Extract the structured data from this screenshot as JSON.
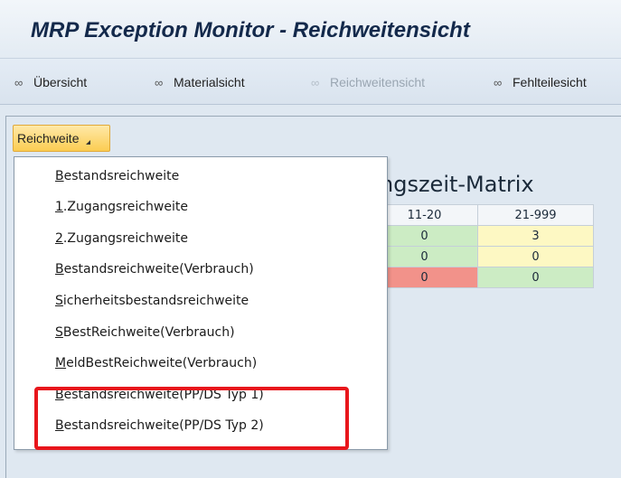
{
  "window": {
    "title": "MRP Exception Monitor - Reichweitensicht"
  },
  "toolbar": {
    "items": [
      {
        "label": "Übersicht",
        "icon": "glasses-icon",
        "enabled": true
      },
      {
        "label": "Materialsicht",
        "icon": "glasses-icon",
        "enabled": true
      },
      {
        "label": "Reichweitensicht",
        "icon": "glasses-icon",
        "enabled": false
      },
      {
        "label": "Fehlteilesicht",
        "icon": "glasses-icon",
        "enabled": true
      }
    ]
  },
  "dropdown": {
    "label": "Reichweite",
    "open": true
  },
  "menu": {
    "items": [
      {
        "accel": "B",
        "rest": "estandsreichweite",
        "highlighted": false
      },
      {
        "accel": "1",
        "rest": ".Zugangsreichweite",
        "highlighted": false
      },
      {
        "accel": "2",
        "rest": ".Zugangsreichweite",
        "highlighted": false
      },
      {
        "accel": "B",
        "rest": "estandsreichweite(Verbrauch)",
        "highlighted": false
      },
      {
        "accel": "S",
        "rest": "icherheitsbestandsreichweite",
        "highlighted": false
      },
      {
        "accel": "S",
        "rest": "BestReichweite(Verbrauch)",
        "highlighted": false
      },
      {
        "accel": "M",
        "rest": "eldBestReichweite(Verbrauch)",
        "highlighted": false
      },
      {
        "accel": "B",
        "rest": "estandsreichweite(PP/DS Typ 1)",
        "highlighted": true
      },
      {
        "accel": "B",
        "rest": "estandsreichweite(PP/DS Typ 2)",
        "highlighted": true
      }
    ],
    "highlight_color": "#e8161c"
  },
  "matrix": {
    "title_fragment": "ngszeit-Matrix",
    "headers": [
      "11-20",
      "21-999"
    ],
    "rows": [
      [
        {
          "value": "0",
          "status": "green"
        },
        {
          "value": "3",
          "status": "yellow"
        }
      ],
      [
        {
          "value": "0",
          "status": "green"
        },
        {
          "value": "0",
          "status": "yellow"
        }
      ],
      [
        {
          "value": "0",
          "status": "red"
        },
        {
          "value": "0",
          "status": "green"
        }
      ]
    ],
    "colors": {
      "green": "#ccecc4",
      "yellow": "#fdf8c3",
      "red": "#f2928a"
    }
  }
}
